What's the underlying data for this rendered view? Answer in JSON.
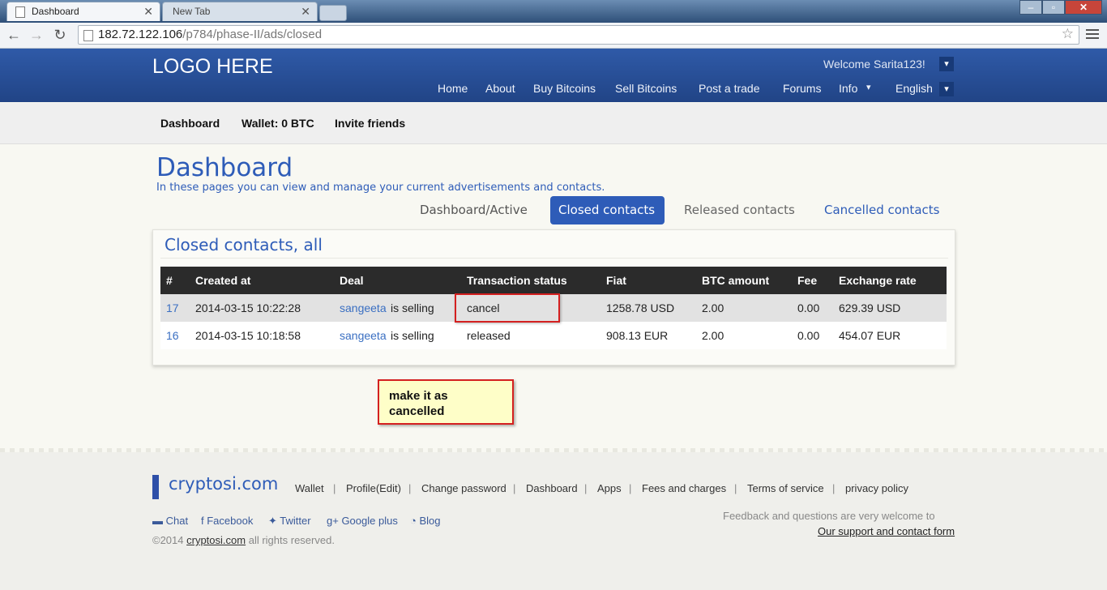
{
  "browser": {
    "tabs": [
      {
        "label": "Dashboard"
      },
      {
        "label": "New Tab"
      }
    ],
    "url_host": "182.72.122.106",
    "url_path": "/p784/phase-II/ads/closed"
  },
  "header": {
    "logo": "LOGO HERE",
    "welcome": "Welcome Sarita123!",
    "nav": [
      "Home",
      "About",
      "Buy Bitcoins",
      "Sell Bitcoins",
      "Post a trade",
      "Forums",
      "Info",
      "English"
    ]
  },
  "subnav": {
    "dashboard": "Dashboard",
    "wallet": "Wallet: 0 BTC",
    "invite": "Invite friends"
  },
  "page": {
    "title": "Dashboard",
    "subtitle": "In these pages you can view and manage your current advertisements and contacts.",
    "tabs": [
      "Dashboard/Active",
      "Closed contacts",
      "Released contacts",
      "Cancelled contacts"
    ],
    "active_tab": "Closed contacts"
  },
  "panel": {
    "title": "Closed contacts, all",
    "columns": [
      "#",
      "Created at",
      "Deal",
      "Transaction status",
      "Fiat",
      "BTC amount",
      "Fee",
      "Exchange rate"
    ],
    "rows": [
      {
        "id": "17",
        "created": "2014-03-15 10:22:28",
        "user": "sangeeta",
        "deal_suffix": "is selling",
        "status": "cancel",
        "fiat": "1258.78 USD",
        "btc": "2.00",
        "fee": "0.00",
        "rate": "629.39 USD"
      },
      {
        "id": "16",
        "created": "2014-03-15 10:18:58",
        "user": "sangeeta",
        "deal_suffix": "is selling",
        "status": "released",
        "fiat": "908.13 EUR",
        "btc": "2.00",
        "fee": "0.00",
        "rate": "454.07 EUR"
      }
    ]
  },
  "annotation": {
    "note": "make it as cancelled"
  },
  "footer": {
    "brand": "cryptosi.com",
    "links": [
      "Wallet",
      "Profile(Edit)",
      "Change password",
      "Dashboard",
      "Apps",
      "Fees and charges",
      "Terms of service",
      "privacy policy"
    ],
    "social": [
      "Chat",
      "Facebook",
      "Twitter",
      "Google plus",
      "Blog"
    ],
    "copyright_prefix": "©2014",
    "copyright_link": "cryptosi.com",
    "copyright_suffix": "all rights reserved.",
    "feedback": "Feedback and questions are very welcome to",
    "contact_link": "Our support and contact form"
  },
  "colors": {
    "brand_blue": "#2e5cb8",
    "header_blue": "#214486",
    "annotation_red": "#d42020"
  }
}
